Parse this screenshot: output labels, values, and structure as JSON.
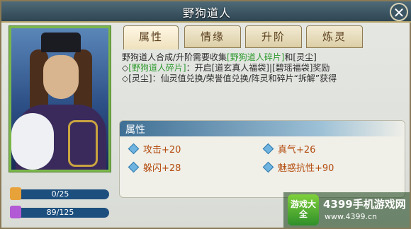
{
  "window": {
    "title": "野狗道人",
    "close_icon": "close-icon"
  },
  "tabs": [
    {
      "label": "属性",
      "active": true
    },
    {
      "label": "情缘",
      "active": false
    },
    {
      "label": "升阶",
      "active": false
    },
    {
      "label": "炼灵",
      "active": false
    }
  ],
  "stats": {
    "fragments": {
      "value": "0/25",
      "icon": "fragment-icon",
      "color": "#e8a23a"
    },
    "spirit_dust": {
      "value": "89/125",
      "icon": "spirit-dust-icon",
      "color": "#b25ad6"
    }
  },
  "description": {
    "line1_a": "野狗道人合成/升阶需要收集",
    "line1_b": "[野狗道人碎片]",
    "line1_c": "和[灵尘]",
    "line2_a": "◇",
    "line2_b": "[野狗道人碎片]",
    "line2_c": "：开启[道玄真人福袋]|[碧瑶福袋]奖励",
    "line3": "◇[灵尘]：仙灵值兑换/荣誉值兑换/阵灵和碎片“拆解”获得"
  },
  "attributes_panel": {
    "title": "属性",
    "items": [
      {
        "label": "攻击+20"
      },
      {
        "label": "真气+26"
      },
      {
        "label": "躲闪+28"
      },
      {
        "label": "魅惑抗性+90"
      }
    ]
  },
  "watermark": {
    "logo_text": "游戏大全",
    "name": "4399手机游戏网",
    "url": "www.4399.cn"
  },
  "colors": {
    "highlight_green": "#2e9a2e",
    "attribute_orange": "#b44c0e",
    "portrait_border": "#7ab64a"
  }
}
